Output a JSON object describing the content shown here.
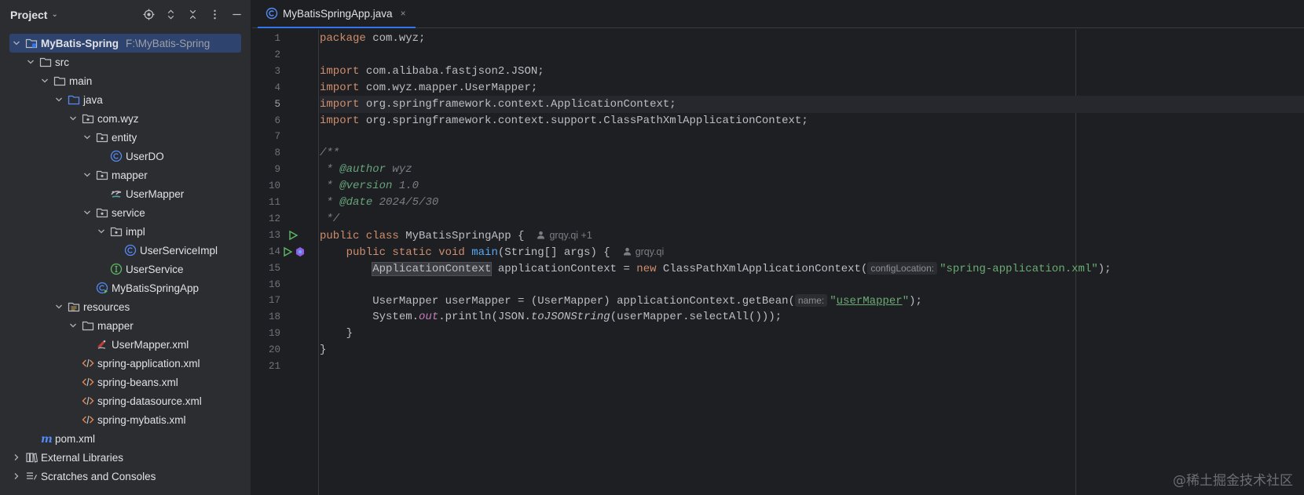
{
  "sidebar": {
    "title": "Project",
    "tools": [
      "locate-icon",
      "expand-icon",
      "collapse-icon",
      "more-icon",
      "minimize-icon"
    ],
    "tree": [
      {
        "label": "MyBatis-Spring",
        "path": "F:\\MyBatis-Spring",
        "icon": "module-icon"
      },
      {
        "label": "src",
        "icon": "folder-icon"
      },
      {
        "label": "main",
        "icon": "folder-icon"
      },
      {
        "label": "java",
        "icon": "source-folder-icon"
      },
      {
        "label": "com.wyz",
        "icon": "package-icon"
      },
      {
        "label": "entity",
        "icon": "package-icon"
      },
      {
        "label": "UserDO",
        "icon": "class-icon"
      },
      {
        "label": "mapper",
        "icon": "package-icon"
      },
      {
        "label": "UserMapper",
        "icon": "mybatis-mapper-icon"
      },
      {
        "label": "service",
        "icon": "package-icon"
      },
      {
        "label": "impl",
        "icon": "package-icon"
      },
      {
        "label": "UserServiceImpl",
        "icon": "class-icon"
      },
      {
        "label": "UserService",
        "icon": "interface-icon"
      },
      {
        "label": "MyBatisSpringApp",
        "icon": "runnable-class-icon"
      },
      {
        "label": "resources",
        "icon": "resources-folder-icon"
      },
      {
        "label": "mapper",
        "icon": "folder-icon"
      },
      {
        "label": "UserMapper.xml",
        "icon": "mybatis-xml-icon"
      },
      {
        "label": "spring-application.xml",
        "icon": "xml-icon"
      },
      {
        "label": "spring-beans.xml",
        "icon": "xml-icon"
      },
      {
        "label": "spring-datasource.xml",
        "icon": "xml-icon"
      },
      {
        "label": "spring-mybatis.xml",
        "icon": "xml-icon"
      },
      {
        "label": "pom.xml",
        "icon": "maven-icon"
      },
      {
        "label": "External Libraries",
        "icon": "library-icon"
      },
      {
        "label": "Scratches and Consoles",
        "icon": "scratches-icon"
      }
    ]
  },
  "editor": {
    "tab": {
      "label": "MyBatisSpringApp.java",
      "close": "×"
    },
    "current_line": 5,
    "line_numbers": [
      "1",
      "2",
      "3",
      "4",
      "5",
      "6",
      "7",
      "8",
      "9",
      "10",
      "11",
      "12",
      "13",
      "14",
      "15",
      "16",
      "17",
      "18",
      "19",
      "20",
      "21"
    ],
    "code": {
      "l1_kw": "package",
      "l1_rest": " com.wyz;",
      "l3_kw": "import",
      "l3_rest": " com.alibaba.fastjson2.JSON;",
      "l4_kw": "import",
      "l4_rest": " com.wyz.mapper.UserMapper;",
      "l5_kw": "import",
      "l5_rest": " org.springframework.context.ApplicationContext;",
      "l6_kw": "import",
      "l6_rest": " org.springframework.context.support.ClassPathXmlApplicationContext;",
      "l8": "/**",
      "l9_a": " * ",
      "l9_tag": "@author",
      "l9_b": " wyz",
      "l10_a": " * ",
      "l10_tag": "@version",
      "l10_b": " 1.0",
      "l11_a": " * ",
      "l11_tag": "@date",
      "l11_b": " 2024/5/30",
      "l12": " */",
      "l13_kw": "public class",
      "l13_rest": " MyBatisSpringApp {",
      "l13_author": "grqy.qi +1",
      "l14_indent": "    ",
      "l14_kw": "public static void",
      "l14_fn": "main",
      "l14_rest": "(String[] args) {",
      "l14_author": "grqy.qi",
      "l15_indent": "        ",
      "l15_type": "ApplicationContext",
      "l15_a": " applicationContext = ",
      "l15_kw": "new",
      "l15_b": " ClassPathXmlApplicationContext(",
      "l15_hint": "configLocation:",
      "l15_str": "\"spring-application.xml\"",
      "l15_end": ");",
      "l17_indent": "        ",
      "l17_a": "UserMapper userMapper = (UserMapper) applicationContext.getBean(",
      "l17_hint": "name:",
      "l17_q1": "\"",
      "l17_link": "userMapper",
      "l17_q2": "\"",
      "l17_end": ");",
      "l18_indent": "        ",
      "l18_a": "System.",
      "l18_fld": "out",
      "l18_b": ".println(JSON.",
      "l18_sfn": "toJSONString",
      "l18_c": "(userMapper.selectAll()));",
      "l19": "    }",
      "l20": "}"
    }
  },
  "watermark": "@稀土掘金技术社区",
  "colors": {
    "selection": "#2e436e",
    "keyword": "#cf8e6d",
    "string": "#6aab73",
    "accent": "#3574f0"
  }
}
